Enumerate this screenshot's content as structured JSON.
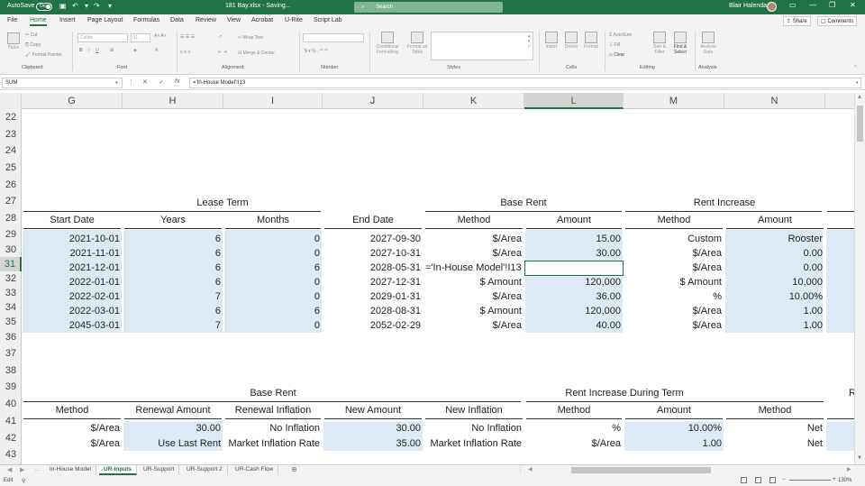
{
  "titlebar": {
    "autosave_label": "AutoSave",
    "autosave_state": "On",
    "filename": "181 Bay.xlsx - Saving...",
    "search_placeholder": "Search",
    "user_name": "Blair Halenda",
    "minimize": "—",
    "restore": "❐",
    "close": "✕"
  },
  "menu": {
    "tabs": [
      "File",
      "Home",
      "Insert",
      "Page Layout",
      "Formulas",
      "Data",
      "Review",
      "View",
      "Acrobat",
      "U-Rite",
      "Script Lab"
    ],
    "active": "Home",
    "share": "Share",
    "comments": "Comments"
  },
  "ribbon": {
    "clipboard": {
      "label": "Clipboard",
      "paste": "Paste",
      "cut": "Cut",
      "copy": "Copy",
      "format_painter": "Format Painter"
    },
    "font": {
      "label": "Font",
      "name": "Calibri",
      "size": "11"
    },
    "alignment": {
      "label": "Alignment",
      "wrap_text": "Wrap Text",
      "merge": "Merge & Center"
    },
    "number": {
      "label": "Number"
    },
    "styles": {
      "label": "Styles",
      "conditional": "Conditional Formatting",
      "format_table": "Format as Table"
    },
    "cells": {
      "label": "Cells",
      "insert": "Insert",
      "delete": "Delete",
      "format": "Format"
    },
    "editing": {
      "label": "Editing",
      "autosum": "AutoSum",
      "fill": "Fill",
      "clear": "Clear",
      "sort": "Sort & Filter",
      "find": "Find & Select"
    },
    "analysis": {
      "label": "Analysis",
      "analyze": "Analyze Data"
    }
  },
  "formula_bar": {
    "name_box": "SUM",
    "cancel": "✕",
    "enter": "✓",
    "fx": "fx",
    "formula": "='In-House Model'!I13"
  },
  "columns": [
    "G",
    "H",
    "I",
    "J",
    "K",
    "L",
    "M",
    "N"
  ],
  "selected_column": "L",
  "rows": [
    "22",
    "23",
    "24",
    "25",
    "26",
    "27",
    "28",
    "29",
    "30",
    "31",
    "32",
    "33",
    "34",
    "35",
    "36",
    "37",
    "38",
    "39",
    "40",
    "41",
    "42",
    "43"
  ],
  "selected_row": "31",
  "section1": {
    "group_lease_term": "Lease Term",
    "group_base_rent": "Base Rent",
    "group_rent_increase": "Rent Increase",
    "headers": [
      "Start Date",
      "Years",
      "Months",
      "End Date",
      "Method",
      "Amount",
      "Method",
      "Amount"
    ],
    "data": [
      [
        "2021-10-01",
        "6",
        "0",
        "2027-09-30",
        "$/Area",
        "15.00",
        "Custom",
        "Rooster"
      ],
      [
        "2021-11-01",
        "6",
        "0",
        "2027-10-31",
        "$/Area",
        "30.00",
        "$/Area",
        "0.00"
      ],
      [
        "2021-12-01",
        "6",
        "6",
        "2028-05-31",
        "='In-House Model'!I13",
        "",
        "$/Area",
        "0.00"
      ],
      [
        "2022-01-01",
        "6",
        "0",
        "2027-12-31",
        "$ Amount",
        "120,000",
        "$ Amount",
        "10,000"
      ],
      [
        "2022-02-01",
        "7",
        "0",
        "2029-01-31",
        "$/Area",
        "36.00",
        "%",
        "10.00%"
      ],
      [
        "2022-03-01",
        "6",
        "6",
        "2028-08-31",
        "$ Amount",
        "120,000",
        "$/Area",
        "1.00"
      ],
      [
        "2045-03-01",
        "7",
        "0",
        "2052-02-29",
        "$/Area",
        "40.00",
        "$/Area",
        "1.00"
      ]
    ]
  },
  "section2": {
    "group_base_rent": "Base Rent",
    "group_increase": "Rent Increase During Term",
    "group_cut": "R",
    "headers": [
      "Method",
      "Renewal Amount",
      "Renewal Inflation",
      "New Amount",
      "New Inflation",
      "Method",
      "Amount",
      "Method"
    ],
    "data": [
      [
        "$/Area",
        "30.00",
        "No Inflation",
        "30.00",
        "No Inflation",
        "%",
        "10.00%",
        "Net"
      ],
      [
        "$/Area",
        "Use Last Rent",
        "Market Inflation Rate",
        "35.00",
        "Market Inflation Rate",
        "$/Area",
        "1.00",
        "Net"
      ]
    ]
  },
  "sheets": [
    "In-House Model",
    "UR-Inputs",
    "UR-Support",
    "UR-Support 2",
    "UR-Cash Flow"
  ],
  "active_sheet": "UR-Inputs",
  "status": {
    "mode": "Edit",
    "zoom": "130%"
  }
}
